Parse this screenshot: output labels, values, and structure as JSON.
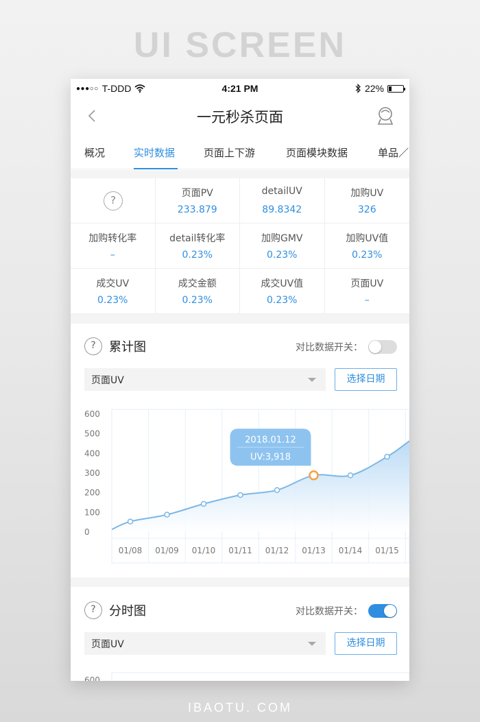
{
  "hero": {
    "title": "UI SCREEN"
  },
  "footer": {
    "brand": "IBAOTU. COM"
  },
  "status_bar": {
    "signal": "●●●○○",
    "carrier": "T-DDD",
    "time": "4:21 PM",
    "battery_percent": "22%",
    "battery_level": 0.22
  },
  "nav": {
    "title": "一元秒杀页面",
    "back_icon": "chevron-left-icon",
    "profile_icon": "user-icon"
  },
  "tabs": [
    {
      "label": "概况",
      "active": false
    },
    {
      "label": "实时数据",
      "active": true
    },
    {
      "label": "页面上下游",
      "active": false
    },
    {
      "label": "页面模块数据",
      "active": false
    },
    {
      "label": "单品／",
      "active": false
    }
  ],
  "metrics": {
    "help": "?",
    "cells": [
      {
        "label": "页面PV",
        "value": "233.879"
      },
      {
        "label": "detailUV",
        "value": "89.8342"
      },
      {
        "label": "加购UV",
        "value": "326"
      },
      {
        "label": "加购转化率",
        "value": "–"
      },
      {
        "label": "detail转化率",
        "value": "0.23%"
      },
      {
        "label": "加购GMV",
        "value": "0.23%"
      },
      {
        "label": "加购UV值",
        "value": "0.23%"
      },
      {
        "label": "成交UV",
        "value": "0.23%"
      },
      {
        "label": "成交金额",
        "value": "0.23%"
      },
      {
        "label": "成交UV值",
        "value": "0.23%"
      },
      {
        "label": "页面UV",
        "value": "–"
      }
    ]
  },
  "cumulative": {
    "help": "?",
    "title": "累计图",
    "toggle_label": "对比数据开关：",
    "toggle_on": false,
    "dropdown_value": "页面UV",
    "date_button": "选择日期",
    "tooltip": {
      "date": "2018.01.12",
      "value": "UV:3,918"
    }
  },
  "hourly": {
    "help": "?",
    "title": "分时图",
    "toggle_label": "对比数据开关：",
    "toggle_on": true,
    "dropdown_value": "页面UV",
    "date_button": "选择日期",
    "y_top_tick": "600"
  },
  "colors": {
    "accent": "#2f8ee0",
    "highlight": "#f5a142",
    "line": "#7bb7e6"
  },
  "chart_data": {
    "type": "area",
    "categories": [
      "01/08",
      "01/09",
      "01/10",
      "01/11",
      "01/12",
      "01/13",
      "01/14",
      "01/15"
    ],
    "x_range": [
      7.5,
      8.75
    ],
    "series": [
      {
        "x": [
          7.5,
          8,
          9,
          10,
          11,
          12,
          13,
          14,
          15,
          15.75
        ],
        "values": [
          10,
          50,
          85,
          140,
          185,
          210,
          285,
          285,
          380,
          460
        ],
        "marker": [
          false,
          true,
          true,
          true,
          true,
          true,
          true,
          true,
          true,
          false
        ]
      }
    ],
    "highlight_index": 6,
    "y_ticks": [
      0,
      100,
      200,
      300,
      400,
      500,
      600
    ],
    "ylim": [
      0,
      600
    ],
    "grid": true,
    "legend": "none"
  }
}
